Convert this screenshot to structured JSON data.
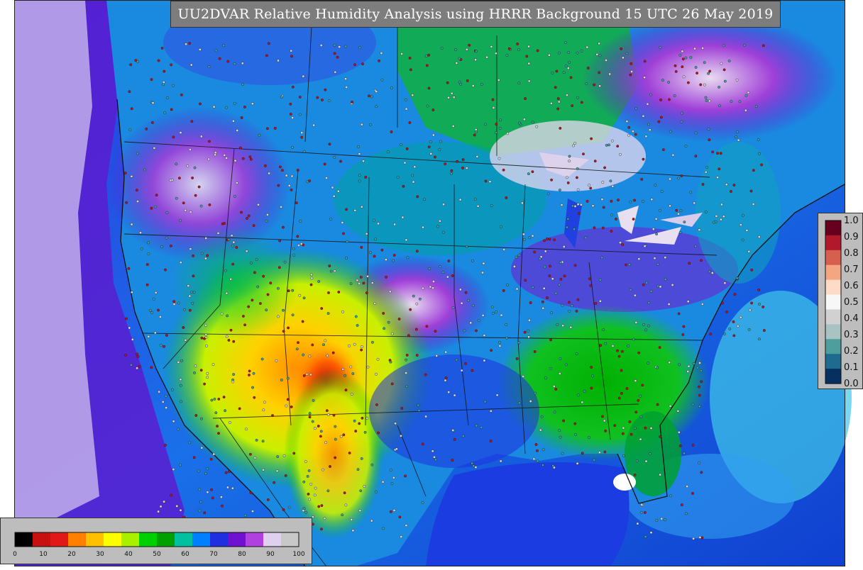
{
  "title": "UU2DVAR Relative Humidity Analysis using HRRR Background 15 UTC 26 May 2019",
  "map": {
    "projection": "lambert-conformal",
    "region": "CONUS",
    "ocean_color": "#1a66e6",
    "land_palette": [
      "#00b000",
      "#00d040",
      "#1a90e0",
      "#2a40e0",
      "#6a10d0",
      "#a020d0",
      "#d8c8e8",
      "#ffff20",
      "#ffc000",
      "#ff8000",
      "#c81010"
    ],
    "observation_marker_colors": [
      "#d8d8d8",
      "#40a0a0",
      "#c01010"
    ]
  },
  "colorbar_rh": {
    "ticks": [
      "0",
      "10",
      "20",
      "30",
      "40",
      "50",
      "60",
      "70",
      "80",
      "90",
      "100"
    ],
    "colors": [
      "#000000",
      "#c81010",
      "#e01818",
      "#ff8000",
      "#ffc000",
      "#ffff00",
      "#a8f000",
      "#00d000",
      "#00a000",
      "#00c0a0",
      "#0080ff",
      "#2030e0",
      "#7010d0",
      "#b040e0",
      "#e0d0f0",
      "#c8c8c8"
    ]
  },
  "colorbar_obs": {
    "ticks": [
      "1.0",
      "0.9",
      "0.8",
      "0.7",
      "0.6",
      "0.5",
      "0.4",
      "0.3",
      "0.2",
      "0.1",
      "0.0"
    ],
    "colors": [
      "#67001f",
      "#b2182b",
      "#d6604d",
      "#f4a582",
      "#fddbc7",
      "#f7f7f7",
      "#d1d1d1",
      "#a9c3c3",
      "#4f9e9e",
      "#1f6b8f",
      "#053061"
    ]
  }
}
